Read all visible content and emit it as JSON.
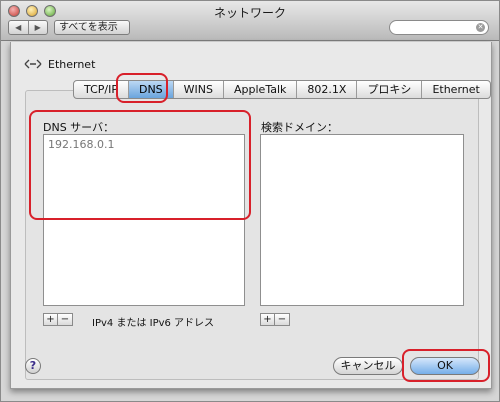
{
  "window": {
    "title": "ネットワーク"
  },
  "toolbar": {
    "back_label": "◀",
    "forward_label": "▶",
    "show_all_label": "すべてを表示"
  },
  "header": {
    "interface_name": "Ethernet"
  },
  "tabs": [
    {
      "label": "TCP/IP"
    },
    {
      "label": "DNS"
    },
    {
      "label": "WINS"
    },
    {
      "label": "AppleTalk"
    },
    {
      "label": "802.1X"
    },
    {
      "label": "プロキシ"
    },
    {
      "label": "Ethernet"
    }
  ],
  "dns": {
    "servers_label": "DNS サーバ：",
    "servers": [
      "192.168.0.1"
    ],
    "search_domains_label": "検索ドメイン：",
    "address_hint": "IPv4 または IPv6 アドレス"
  },
  "buttons": {
    "add_label": "+",
    "remove_label": "−",
    "help_label": "?",
    "cancel_label": "キャンセル",
    "ok_label": "OK"
  }
}
